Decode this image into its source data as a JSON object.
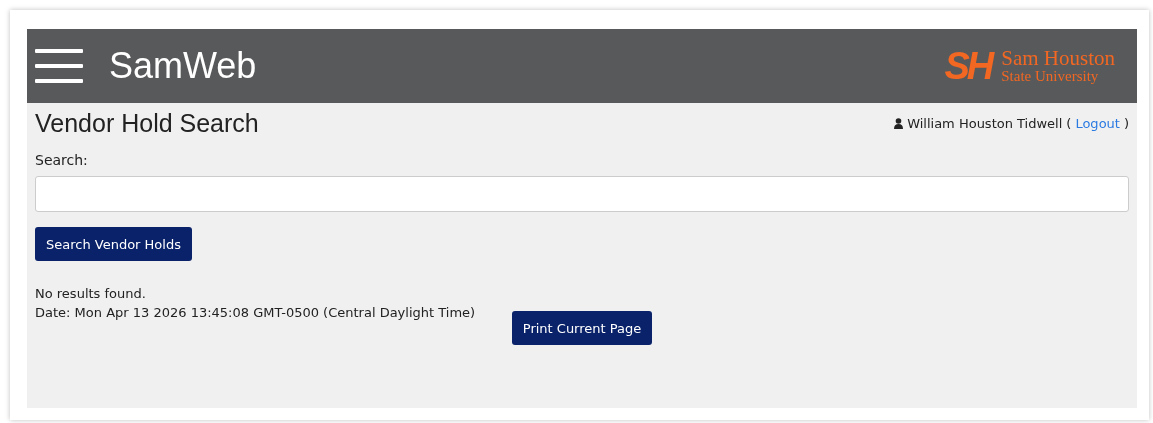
{
  "header": {
    "title": "SamWeb",
    "logo": {
      "mark": "SH",
      "name": "Sam Houston",
      "subtitle": "State University"
    }
  },
  "page": {
    "heading": "Vendor Hold Search",
    "user": {
      "name": "William Houston Tidwell",
      "open_paren": "(",
      "logout": "Logout",
      "close_paren": ")"
    }
  },
  "search": {
    "label": "Search:",
    "button": "Search Vendor Holds"
  },
  "results": {
    "message": "No results found.",
    "date": "Date: Mon Apr 13 2026 13:45:08 GMT-0500 (Central Daylight Time)"
  },
  "print_button": "Print Current Page"
}
